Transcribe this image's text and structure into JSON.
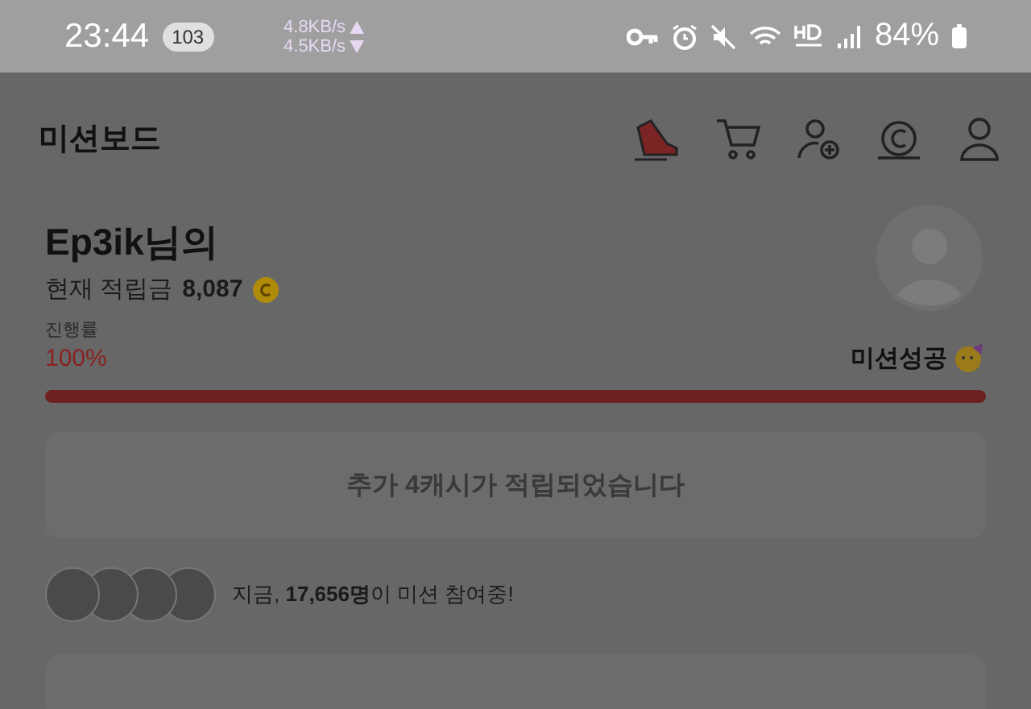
{
  "status_bar": {
    "time": "23:44",
    "notification_count": "103",
    "upload_speed": "4.8KB/s",
    "download_speed": "4.5KB/s",
    "battery": "84%"
  },
  "header": {
    "title": "미션보드"
  },
  "user": {
    "name": "Ep3ik님의",
    "points_label": "현재 적립금",
    "points": "8,087"
  },
  "progress": {
    "label": "진행률",
    "percent": "100%",
    "level": 1,
    "status": "미션성공"
  },
  "reward_message": "추가 4캐시가 적립되었습니다",
  "participants": {
    "text": "지금, **17,656명**이 미션 참여중!"
  }
}
